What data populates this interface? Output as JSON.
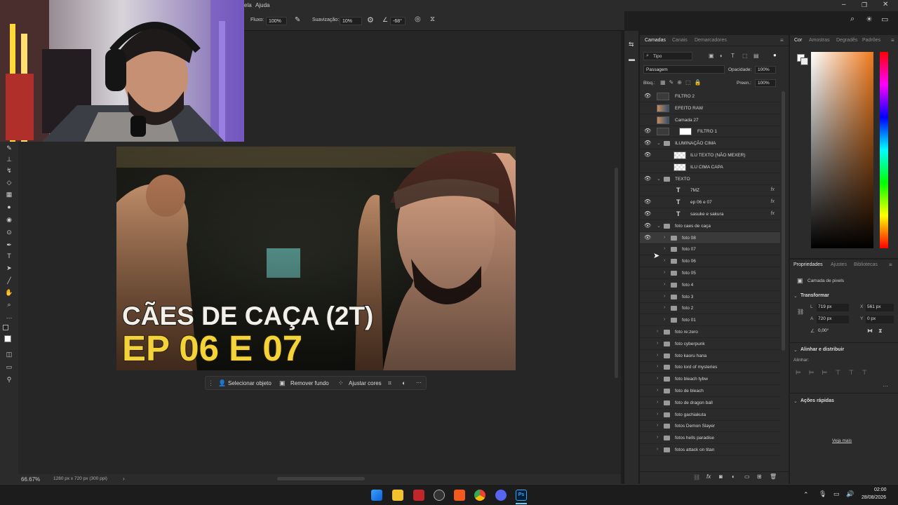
{
  "menu": {
    "item_partial": "ela",
    "help": "Ajuda"
  },
  "options": {
    "flow_label": "Fluxo:",
    "flow_value": "100%",
    "smoothing_label": "Suavização:",
    "smoothing_value": "10%",
    "angle_value": "-68°"
  },
  "canvas_text": {
    "line1": "CÃES DE CAÇA (2T)",
    "line2": "EP 06 E 07"
  },
  "context_bar": {
    "select_object": "Selecionar objeto",
    "remove_background": "Remover fundo",
    "adjust_colors": "Ajustar cores",
    "more": "···"
  },
  "status": {
    "zoom": "66.67%",
    "doc_info": "1280 px x 720 px (300 ppi)",
    "arrow": "›"
  },
  "layers_panel": {
    "tabs": [
      "Camadas",
      "Canais",
      "Demarcadores"
    ],
    "filter_label": "Tipo",
    "blend_mode": "Passagem",
    "opacity_label": "Opacidade:",
    "opacity_value": "100%",
    "lock_label": "Bloq.:",
    "fill_label": "Preen.:",
    "fill_value": "100%",
    "layers": [
      {
        "name": "FILTRO 2",
        "kind": "smart",
        "eye": true,
        "indent": 0
      },
      {
        "name": "EFEITO RAW",
        "kind": "image",
        "eye": false,
        "indent": 0
      },
      {
        "name": "Camada 27",
        "kind": "image",
        "eye": false,
        "indent": 0
      },
      {
        "name": "FILTRO 1",
        "kind": "smart-mask",
        "eye": true,
        "indent": 0
      },
      {
        "name": "ILUMINAÇÃO CIMA",
        "kind": "group-open",
        "eye": true,
        "indent": 0
      },
      {
        "name": "ILU TEXTO (NÃO MEXER)",
        "kind": "transparent",
        "eye": true,
        "indent": 1
      },
      {
        "name": "ILU CIMA CAPA",
        "kind": "transparent",
        "eye": false,
        "indent": 1
      },
      {
        "name": "TEXTO",
        "kind": "group-open",
        "eye": true,
        "indent": 0
      },
      {
        "name": "7MZ",
        "kind": "text",
        "eye": false,
        "indent": 1,
        "fx": true
      },
      {
        "name": "ep 06 e 07",
        "kind": "text",
        "eye": true,
        "indent": 1,
        "fx": true
      },
      {
        "name": "sasuke e sakura",
        "kind": "text",
        "eye": true,
        "indent": 1,
        "fx": true
      },
      {
        "name": "foto caes de caça",
        "kind": "group-open",
        "eye": true,
        "indent": 0
      },
      {
        "name": "foto 08",
        "kind": "group",
        "eye": true,
        "indent": 1,
        "selected": true
      },
      {
        "name": "foto 07",
        "kind": "group",
        "eye": false,
        "indent": 1
      },
      {
        "name": "foto 06",
        "kind": "group",
        "eye": false,
        "indent": 1
      },
      {
        "name": "foto 05",
        "kind": "group",
        "eye": false,
        "indent": 1
      },
      {
        "name": "foto 4",
        "kind": "group",
        "eye": false,
        "indent": 1
      },
      {
        "name": "foto 3",
        "kind": "group",
        "eye": false,
        "indent": 1
      },
      {
        "name": "foto 2",
        "kind": "group",
        "eye": false,
        "indent": 1
      },
      {
        "name": "foto 01",
        "kind": "group",
        "eye": false,
        "indent": 1
      },
      {
        "name": "foto re:zero",
        "kind": "group",
        "eye": false,
        "indent": 0
      },
      {
        "name": "foto cyberpunk",
        "kind": "group",
        "eye": false,
        "indent": 0
      },
      {
        "name": "foto kaoru hana",
        "kind": "group",
        "eye": false,
        "indent": 0
      },
      {
        "name": "foto lord of mysteries",
        "kind": "group",
        "eye": false,
        "indent": 0
      },
      {
        "name": "foto bleach tybw",
        "kind": "group",
        "eye": false,
        "indent": 0
      },
      {
        "name": "foto de bleach",
        "kind": "group",
        "eye": false,
        "indent": 0
      },
      {
        "name": "foto de dragon ball",
        "kind": "group",
        "eye": false,
        "indent": 0
      },
      {
        "name": "foto gachiakuta",
        "kind": "group",
        "eye": false,
        "indent": 0
      },
      {
        "name": "fotos Demon Slayer",
        "kind": "group",
        "eye": false,
        "indent": 0
      },
      {
        "name": "fotos hells paradise",
        "kind": "group",
        "eye": false,
        "indent": 0
      },
      {
        "name": "fotos attack on titan",
        "kind": "group",
        "eye": false,
        "indent": 0
      }
    ]
  },
  "color_panel": {
    "tabs": [
      "Cor",
      "Amostras",
      "Degradês",
      "Padrões"
    ]
  },
  "properties": {
    "tabs": [
      "Propriedades",
      "Ajustes",
      "Bibliotecas"
    ],
    "layer_type": "Camada de pixels",
    "transform_title": "Transformar",
    "w_label": "L",
    "w_value": "719 px",
    "h_label": "A",
    "h_value": "720 px",
    "x_label": "X",
    "x_value": "561 px",
    "y_label": "Y",
    "y_value": "0 px",
    "angle_value": "0,00°",
    "align_title": "Alinhar e distribuir",
    "align_label": "Alinhar:",
    "quick_title": "Ações rápidas",
    "see_more": "Veja mais"
  },
  "taskbar": {
    "time": "02:00",
    "date": "28/08/2026"
  }
}
